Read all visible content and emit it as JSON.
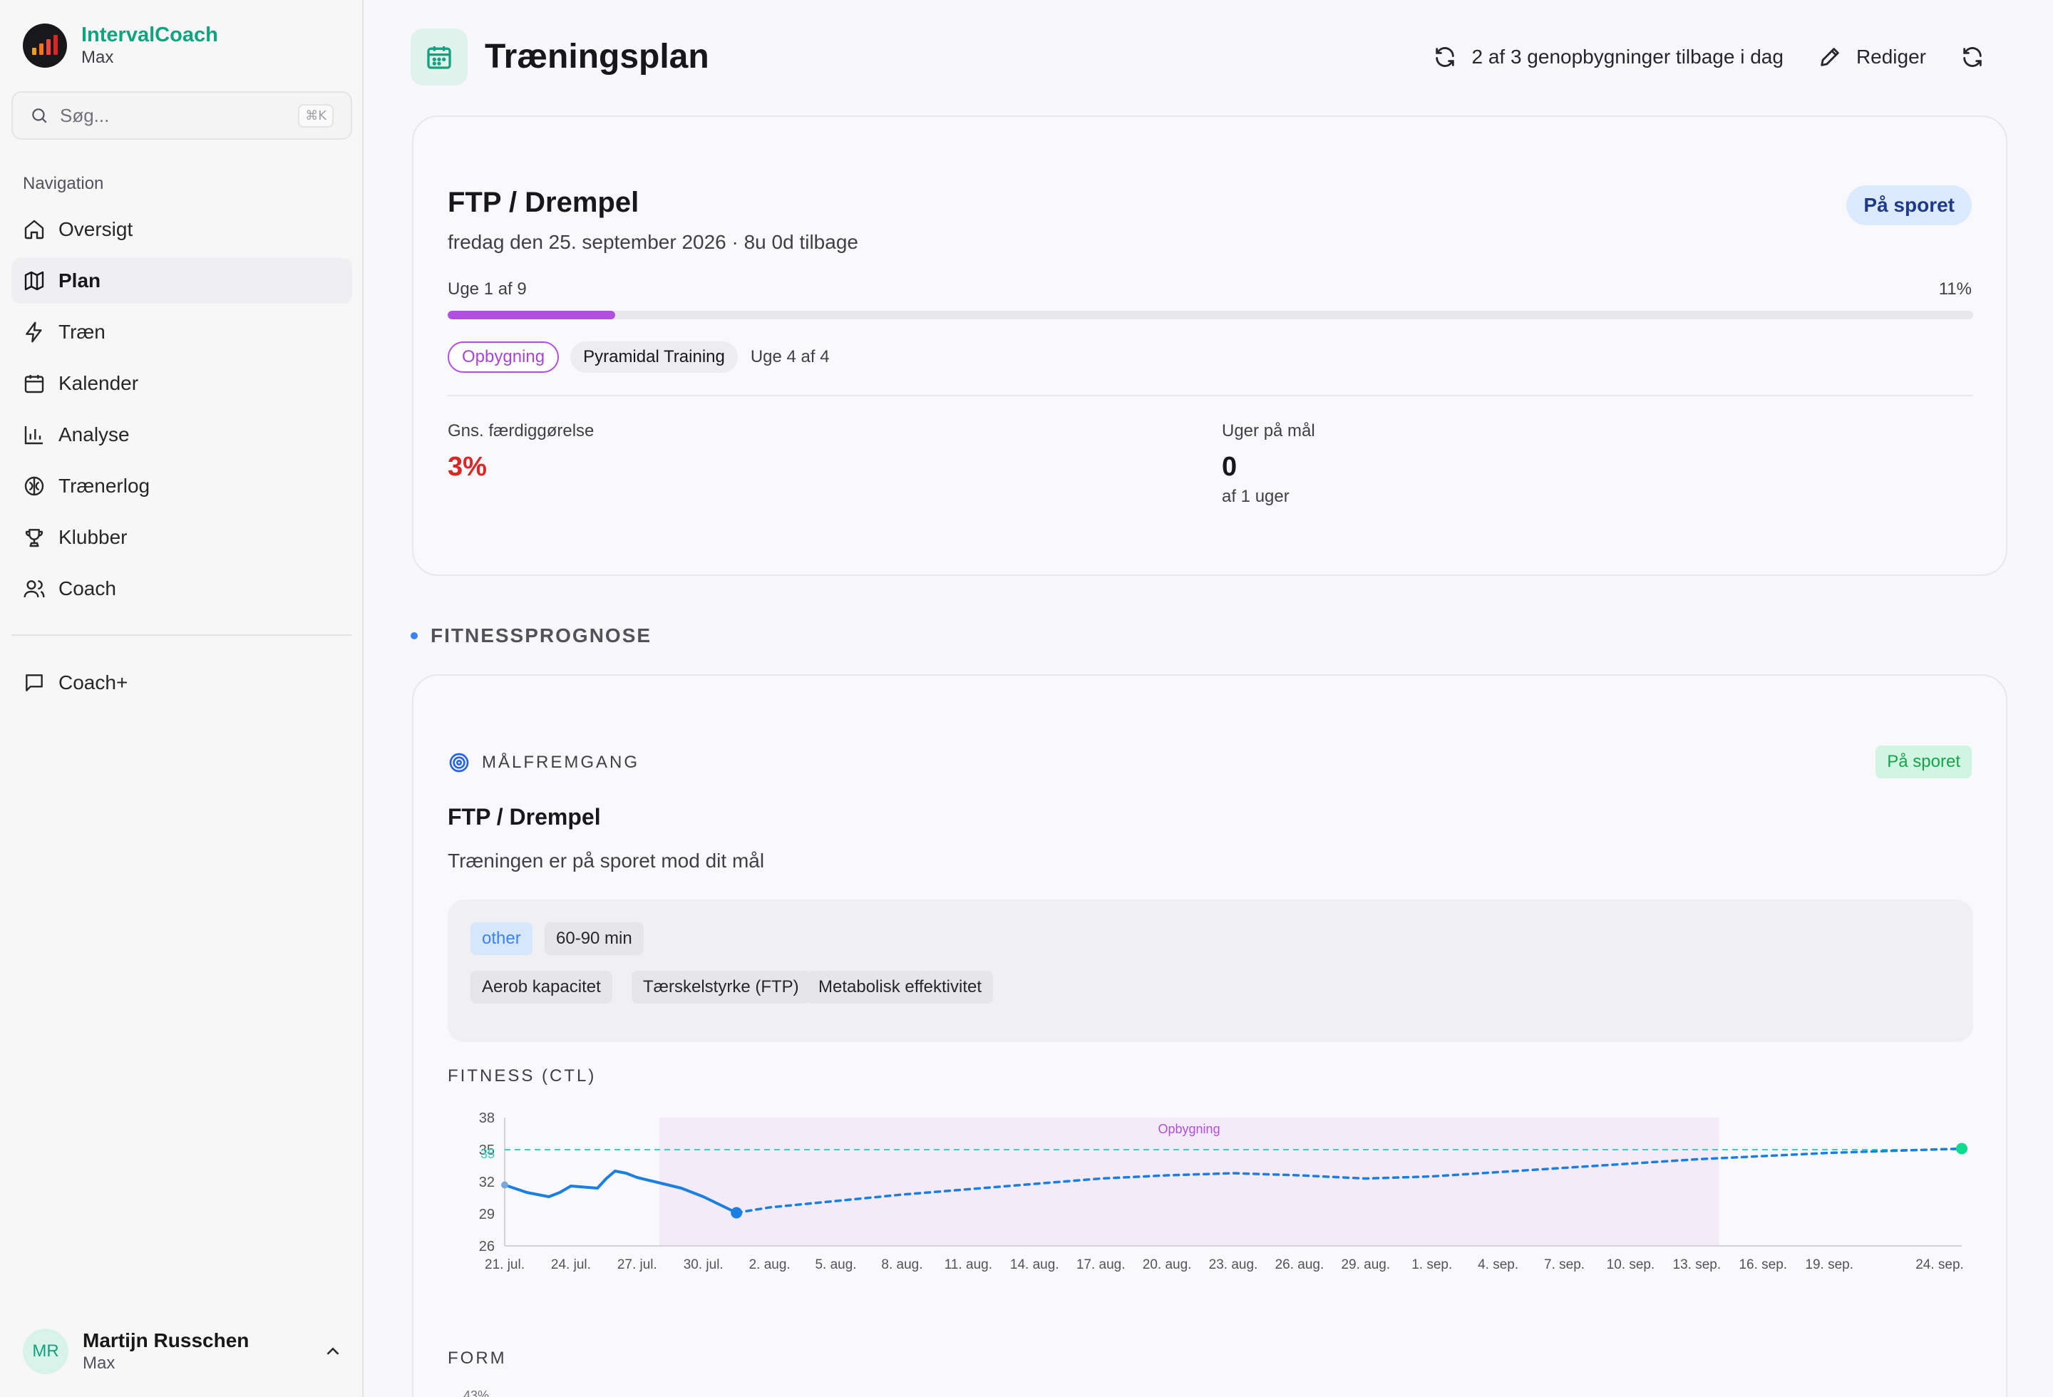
{
  "app": {
    "name": "IntervalCoach",
    "subtitle": "Max",
    "logo_bars": [
      "#f59e0b",
      "#f97316",
      "#ef4444",
      "#dc2626"
    ]
  },
  "search": {
    "placeholder": "Søg...",
    "shortcut": "⌘K"
  },
  "sidebar": {
    "nav_label": "Navigation",
    "items": [
      {
        "label": "Oversigt",
        "icon": "home-icon"
      },
      {
        "label": "Plan",
        "icon": "map-icon",
        "active": true
      },
      {
        "label": "Træn",
        "icon": "zap-icon"
      },
      {
        "label": "Kalender",
        "icon": "calendar-icon"
      },
      {
        "label": "Analyse",
        "icon": "bar-chart-icon"
      },
      {
        "label": "Trænerlog",
        "icon": "brain-icon"
      },
      {
        "label": "Klubber",
        "icon": "trophy-icon"
      },
      {
        "label": "Coach",
        "icon": "users-icon"
      }
    ],
    "secondary": [
      {
        "label": "Coach+",
        "icon": "message-icon"
      }
    ]
  },
  "user": {
    "initials": "MR",
    "name": "Martijn Russchen",
    "plan": "Max"
  },
  "header": {
    "title": "Træningsplan",
    "rebuilds": "2 af 3 genopbygninger tilbage i dag",
    "edit": "Rediger"
  },
  "plan": {
    "goal": "FTP / Drempel",
    "date": "fredag den 25. september 2026 · 8u 0d tilbage",
    "status": "På sporet",
    "week_label": "Uge 1 af 9",
    "progress_pct": "11%",
    "progress_value": 11,
    "phase_chip": "Opbygning",
    "block_chip": "Pyramidal Training",
    "block_week": "Uge 4 af 4",
    "stats": {
      "completion_label": "Gns. færdiggørelse",
      "completion_value": "3%",
      "weeks_label": "Uger på mål",
      "weeks_value": "0",
      "weeks_sub": "af 1 uger"
    },
    "accent_color": "#b24ee0"
  },
  "forecast": {
    "section_title": "FITNESSPROGNOSE",
    "goal_label": "MÅLFREMGANG",
    "status": "På sporet",
    "title": "FTP / Drempel",
    "description": "Træningen er på sporet mod dit mål",
    "tags_row1": [
      "other",
      "60-90 min"
    ],
    "tags_row2": [
      "Aerob kapacitet",
      "Tærskelstyrke (FTP)",
      "Metabolisk effektivitet"
    ],
    "chart_title": "FITNESS (CTL)",
    "form_title": "FORM",
    "form_tick": "43%"
  },
  "chart_data": {
    "type": "line",
    "ylim": [
      26,
      38
    ],
    "yticks": [
      38,
      35,
      32,
      29,
      26
    ],
    "target": 35,
    "target_label": "35",
    "phase_band": {
      "label": "Opbygning",
      "start_day": 7,
      "end_day": 55
    },
    "xticks": [
      "21. jul.",
      "24. jul.",
      "27. jul.",
      "30. jul.",
      "2. aug.",
      "5. aug.",
      "8. aug.",
      "11. aug.",
      "14. aug.",
      "17. aug.",
      "20. aug.",
      "23. aug.",
      "26. aug.",
      "29. aug.",
      "1. sep.",
      "4. sep.",
      "7. sep.",
      "10. sep.",
      "13. sep.",
      "16. sep.",
      "19. sep.",
      "24. sep."
    ],
    "xtick_days": [
      0,
      3,
      6,
      9,
      12,
      15,
      18,
      21,
      24,
      27,
      30,
      33,
      36,
      39,
      42,
      45,
      48,
      51,
      54,
      57,
      60,
      65
    ],
    "x_max_day": 66,
    "series": [
      {
        "kind": "actual",
        "points": [
          [
            0,
            31.7
          ],
          [
            1,
            31.0
          ],
          [
            2,
            30.6
          ],
          [
            2.5,
            31.0
          ],
          [
            3,
            31.6
          ],
          [
            3.6,
            31.5
          ],
          [
            4.2,
            31.4
          ],
          [
            4.6,
            32.3
          ],
          [
            5,
            33.0
          ],
          [
            5.5,
            32.8
          ],
          [
            6,
            32.4
          ],
          [
            7,
            31.9
          ],
          [
            8,
            31.4
          ],
          [
            9,
            30.6
          ],
          [
            10.5,
            29.1
          ]
        ]
      },
      {
        "kind": "projected",
        "points": [
          [
            10.5,
            29.1
          ],
          [
            12,
            29.6
          ],
          [
            15,
            30.2
          ],
          [
            18,
            30.8
          ],
          [
            21,
            31.3
          ],
          [
            24,
            31.8
          ],
          [
            27,
            32.3
          ],
          [
            30,
            32.6
          ],
          [
            33,
            32.8
          ],
          [
            36,
            32.6
          ],
          [
            39,
            32.3
          ],
          [
            42,
            32.5
          ],
          [
            45,
            32.9
          ],
          [
            48,
            33.3
          ],
          [
            51,
            33.7
          ],
          [
            54,
            34.1
          ],
          [
            57,
            34.4
          ],
          [
            60,
            34.7
          ],
          [
            66,
            35.1
          ]
        ]
      }
    ],
    "colors": {
      "line": "#1a7fe0",
      "target": "#2dd4bf",
      "band": "#f3ebf8",
      "band_label": "#b24ee0",
      "end": "#10d990"
    }
  }
}
